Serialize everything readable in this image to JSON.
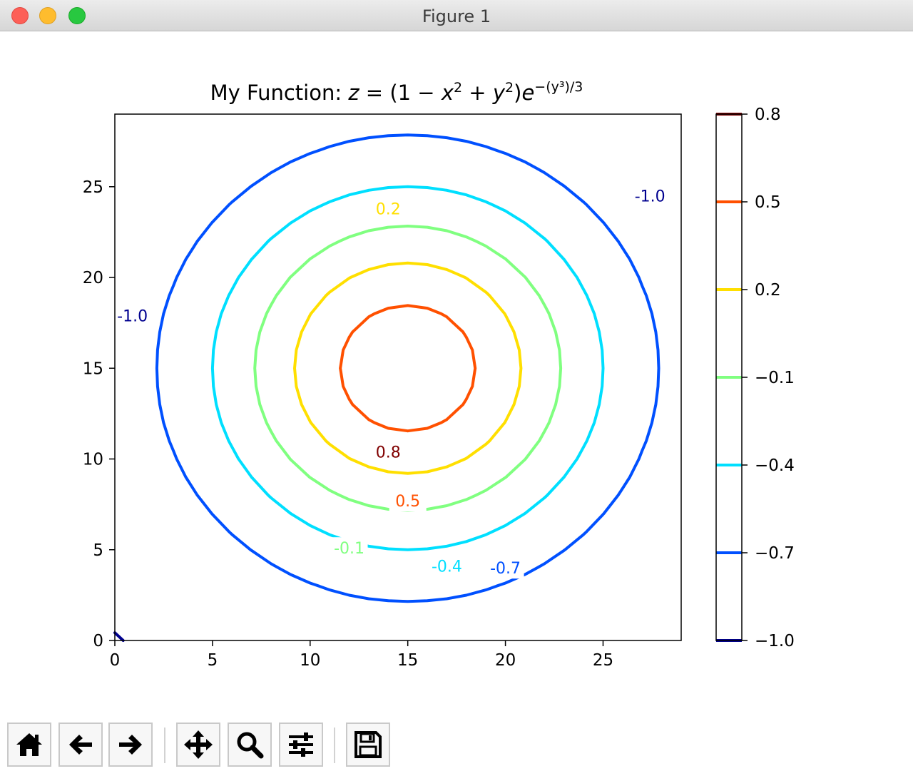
{
  "window": {
    "title": "Figure 1"
  },
  "chart_data": {
    "type": "contour",
    "title": "My Function: z = (1 − x² + y²)e^−(y³)/3",
    "xlim": [
      0,
      29
    ],
    "ylim": [
      0,
      29
    ],
    "x_ticks": [
      "0",
      "5",
      "10",
      "15",
      "20",
      "25"
    ],
    "y_ticks": [
      "0",
      "5",
      "10",
      "15",
      "20",
      "25"
    ],
    "levels": [
      -1.0,
      -0.7,
      -0.4,
      -0.1,
      0.2,
      0.5,
      0.8
    ],
    "level_colors": [
      "#00008f",
      "#0050ff",
      "#00dfff",
      "#80ff80",
      "#ffdf00",
      "#ff5000",
      "#800000"
    ],
    "colorbar_ticks": [
      "0.8",
      "0.5",
      "0.2",
      "−0.1",
      "−0.4",
      "−0.7",
      "−1.0"
    ],
    "contour_labels": [
      {
        "text": "0.8",
        "x": 14.0,
        "y": 10.4,
        "color": "#800000"
      },
      {
        "text": "0.5",
        "x": 15.0,
        "y": 7.7,
        "color": "#ff5000"
      },
      {
        "text": "0.2",
        "x": 14.0,
        "y": 23.8,
        "color": "#ffdf00"
      },
      {
        "text": "-0.1",
        "x": 12.0,
        "y": 5.1,
        "color": "#80ff80"
      },
      {
        "text": "-0.4",
        "x": 17.0,
        "y": 4.1,
        "color": "#00dfff"
      },
      {
        "text": "-0.7",
        "x": 20.0,
        "y": 4.0,
        "color": "#0050ff"
      },
      {
        "text": "-1.0",
        "x": 0.9,
        "y": 17.9,
        "color": "#00008f"
      },
      {
        "text": "-1.0",
        "x": 27.4,
        "y": 24.5,
        "color": "#00008f"
      }
    ]
  },
  "toolbar": [
    {
      "name": "home-icon"
    },
    {
      "name": "back-arrow-icon"
    },
    {
      "name": "forward-arrow-icon"
    },
    {
      "name": "pan-move-icon"
    },
    {
      "name": "zoom-magnifier-icon"
    },
    {
      "name": "configure-subplots-icon"
    },
    {
      "name": "save-floppy-icon"
    }
  ]
}
